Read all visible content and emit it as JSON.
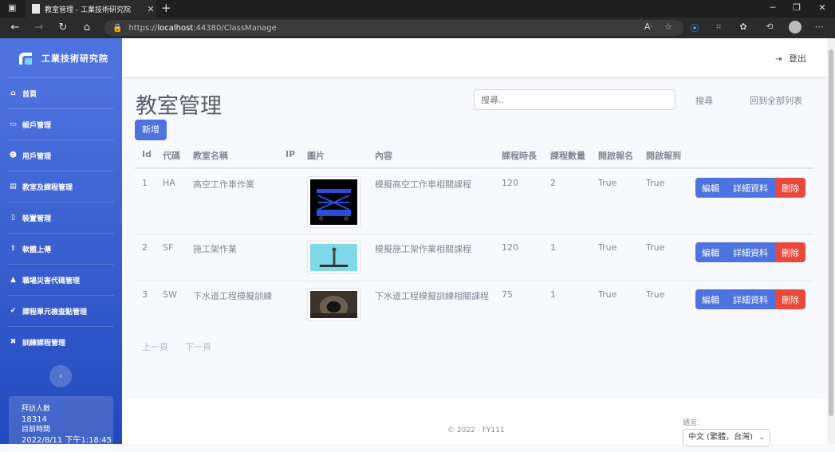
{
  "browser": {
    "tab_title": "教室管理 - 工業技術研究院",
    "url_scheme": "https://",
    "url_host": "localhost",
    "url_rest": ":44380/ClassManage"
  },
  "sidebar": {
    "brand": "工業技術研究院",
    "items": [
      {
        "label": "首頁",
        "icon": "home-icon",
        "glyph": "⌂"
      },
      {
        "label": "帳戶管理",
        "icon": "id-card-icon",
        "glyph": "▭"
      },
      {
        "label": "用戶管理",
        "icon": "users-icon",
        "glyph": "☻"
      },
      {
        "label": "教室及課程管理",
        "icon": "chalkboard-icon",
        "glyph": "▤"
      },
      {
        "label": "裝置管理",
        "icon": "mobile-icon",
        "glyph": "▯"
      },
      {
        "label": "軟體上傳",
        "icon": "upload-icon",
        "glyph": "⇪"
      },
      {
        "label": "職場災害代碼管理",
        "icon": "warning-icon",
        "glyph": "▲"
      },
      {
        "label": "課程單元檢查點管理",
        "icon": "check-circle-icon",
        "glyph": "✔"
      },
      {
        "label": "訓練課程管理",
        "icon": "tools-icon",
        "glyph": "✖"
      }
    ],
    "toggle_glyph": "‹",
    "visits_label": "拜訪人數",
    "visits_count": "18314",
    "time_label": "目前時間",
    "time_value": "2022/8/11 下午1:18:45"
  },
  "topbar": {
    "logout_label": "登出",
    "logout_glyph": "⇥"
  },
  "page": {
    "title": "教室管理",
    "search_placeholder": "搜尋..",
    "search_link": "搜尋",
    "all_link": "回到全部列表",
    "add_button": "新增"
  },
  "table": {
    "headers": [
      "Id",
      "代碼",
      "教室名稱",
      "IP",
      "圖片",
      "內容",
      "課程時長",
      "課程數量",
      "開啟報名",
      "開啟報到"
    ],
    "rows": [
      {
        "id": "1",
        "code": "HA",
        "name": "高空工作車作業",
        "ip": "",
        "content": "模擬高空工作車相關課程",
        "duration": "120",
        "count": "2",
        "signup": "True",
        "checkin": "True"
      },
      {
        "id": "2",
        "code": "SF",
        "name": "施工架作業",
        "ip": "",
        "content": "模擬施工架作業相關課程",
        "duration": "120",
        "count": "1",
        "signup": "True",
        "checkin": "True"
      },
      {
        "id": "3",
        "code": "SW",
        "name": "下水道工程模擬訓練",
        "ip": "",
        "content": "下水道工程模擬訓練相關課程",
        "duration": "75",
        "count": "1",
        "signup": "True",
        "checkin": "True"
      }
    ],
    "edit_label": "編輯",
    "detail_label": "詳細資料",
    "delete_label": "刪除"
  },
  "pager": {
    "prev": "上一頁",
    "next": "下一頁"
  },
  "footer": {
    "copyright": "© 2022 - FY111",
    "lang_label": "語言:",
    "lang_value": "中文 (繁體，台灣)"
  },
  "colors": {
    "primary": "#4e73df",
    "danger": "#e74a3b",
    "sidebar_dark": "#224abe"
  }
}
